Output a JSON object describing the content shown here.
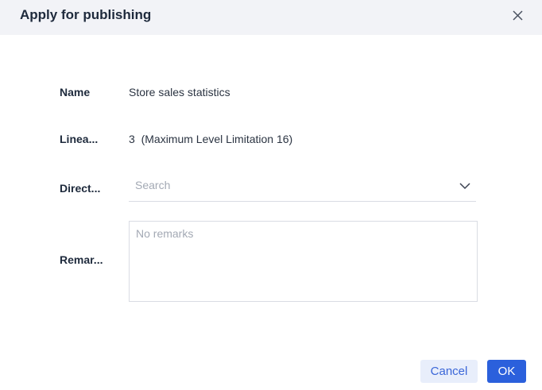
{
  "dialog": {
    "title": "Apply for publishing"
  },
  "form": {
    "name_label": "Name",
    "name_value": "Store sales statistics",
    "lineage_label": "Linea...",
    "lineage_value": "3",
    "lineage_note": "(Maximum Level Limitation 16)",
    "directory_label": "Direct...",
    "directory_placeholder": "Search",
    "remarks_label": "Remar...",
    "remarks_placeholder": "No remarks"
  },
  "footer": {
    "cancel_label": "Cancel",
    "ok_label": "OK"
  },
  "colors": {
    "primary": "#2b60dc",
    "secondary_bg": "#e8eefb",
    "header_bg": "#f2f3f7"
  }
}
